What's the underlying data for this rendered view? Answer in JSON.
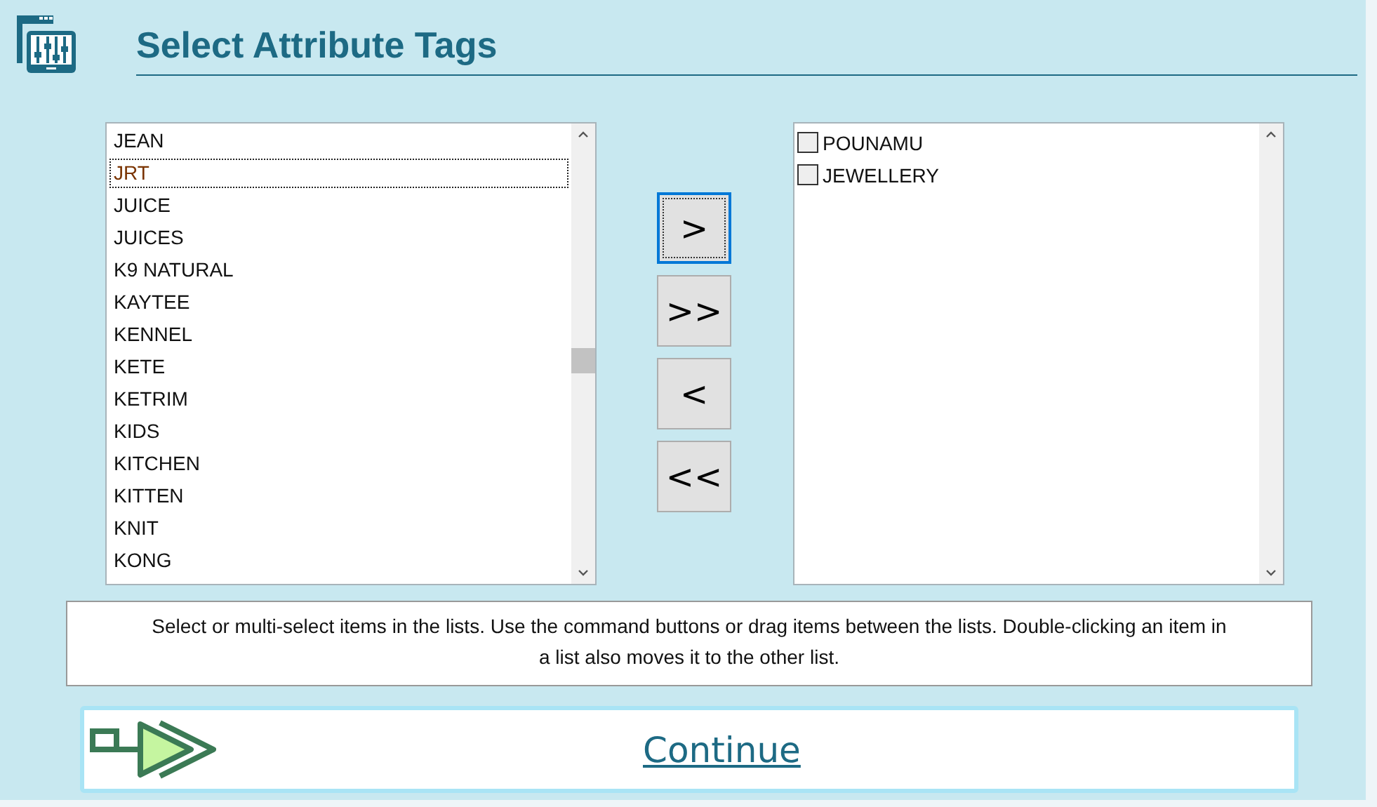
{
  "header": {
    "title": "Select Attribute Tags"
  },
  "available_list": {
    "items": [
      {
        "label": "JEAN",
        "focused": false
      },
      {
        "label": "JRT",
        "focused": true
      },
      {
        "label": "JUICE",
        "focused": false
      },
      {
        "label": "JUICES",
        "focused": false
      },
      {
        "label": "K9 NATURAL",
        "focused": false
      },
      {
        "label": "KAYTEE",
        "focused": false
      },
      {
        "label": "KENNEL",
        "focused": false
      },
      {
        "label": "KETE",
        "focused": false
      },
      {
        "label": "KETRIM",
        "focused": false
      },
      {
        "label": "KIDS",
        "focused": false
      },
      {
        "label": "KITCHEN",
        "focused": false
      },
      {
        "label": "KITTEN",
        "focused": false
      },
      {
        "label": "KNIT",
        "focused": false
      },
      {
        "label": "KONG",
        "focused": false
      }
    ]
  },
  "move_buttons": [
    {
      "label": ">",
      "focused": true
    },
    {
      "label": ">>",
      "focused": false
    },
    {
      "label": "<",
      "focused": false
    },
    {
      "label": "<<",
      "focused": false
    }
  ],
  "selected_list": {
    "items": [
      {
        "label": "POUNAMU",
        "checked": false
      },
      {
        "label": "JEWELLERY",
        "checked": false
      }
    ]
  },
  "help_text": "Select or multi-select items in the lists. Use the command buttons or drag items between the lists. Double-clicking an item in a list also moves it to the other list.",
  "continue_button": {
    "label": "Continue"
  }
}
